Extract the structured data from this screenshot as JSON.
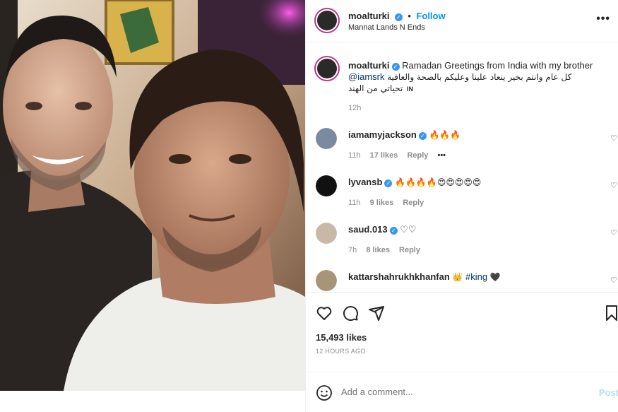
{
  "post": {
    "author": "moalturki",
    "follow_label": "Follow",
    "location": "Mannat Lands N Ends",
    "more_label": "•••",
    "caption": {
      "username": "moalturki",
      "text": "Ramadan Greetings from India with my brother",
      "mention": "@iamsrk",
      "arabic": "كل عام وانتم بخير ينعاد علينا وعليكم بالصحة والعافية تحياتي من الهند",
      "flag": "IN",
      "time": "12h"
    },
    "comments": [
      {
        "username": "iamamyjackson",
        "verified": true,
        "text": "🔥🔥🔥",
        "time": "11h",
        "likes": "17 likes",
        "reply": "Reply",
        "more": "•••"
      },
      {
        "username": "lyvansb",
        "verified": true,
        "text": "🔥🔥🔥🔥😍😍😍😍😍",
        "time": "11h",
        "likes": "9 likes",
        "reply": "Reply"
      },
      {
        "username": "saud.013",
        "verified": true,
        "text": "♡♡",
        "time": "7h",
        "likes": "8 likes",
        "reply": "Reply"
      },
      {
        "username": "kattarshahrukhkhanfan",
        "verified": false,
        "text": "👑",
        "hashtag": "#king",
        "heart": "🖤"
      }
    ],
    "likes": "15,493 likes",
    "posted_ago": "12 HOURS AGO",
    "add_comment_placeholder": "Add a comment...",
    "post_label": "Post"
  },
  "colors": {
    "accent": "#0095f6",
    "verified": "#3897f0",
    "muted": "#8e8e8e",
    "post_disabled": "#b2dffc"
  },
  "icons": [
    "heart-icon",
    "comment-icon",
    "share-icon",
    "bookmark-icon",
    "emoji-icon",
    "verified-icon",
    "more-icon"
  ]
}
